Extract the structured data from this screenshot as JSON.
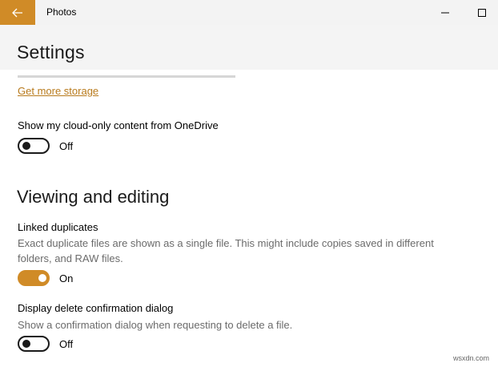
{
  "app": {
    "title": "Photos",
    "accent_color": "#d08b27"
  },
  "titlebar": {
    "back_icon": "arrow-left-icon",
    "minimize_icon": "minimize-icon",
    "maximize_icon": "maximize-icon"
  },
  "header": {
    "title": "Settings"
  },
  "storage": {
    "link_label": "Get more storage"
  },
  "cloud": {
    "label": "Show my cloud-only content from OneDrive",
    "state_label": "Off",
    "is_on": false
  },
  "viewing_editing": {
    "section_title": "Viewing and editing",
    "linked_duplicates": {
      "label": "Linked duplicates",
      "description": "Exact duplicate files are shown as a single file. This might include copies saved in different folders, and RAW files.",
      "state_label": "On",
      "is_on": true
    },
    "delete_confirmation": {
      "label": "Display delete confirmation dialog",
      "description": "Show a confirmation dialog when requesting to delete a file.",
      "state_label": "Off",
      "is_on": false
    }
  },
  "watermark": {
    "text": "wsxdn.com"
  }
}
